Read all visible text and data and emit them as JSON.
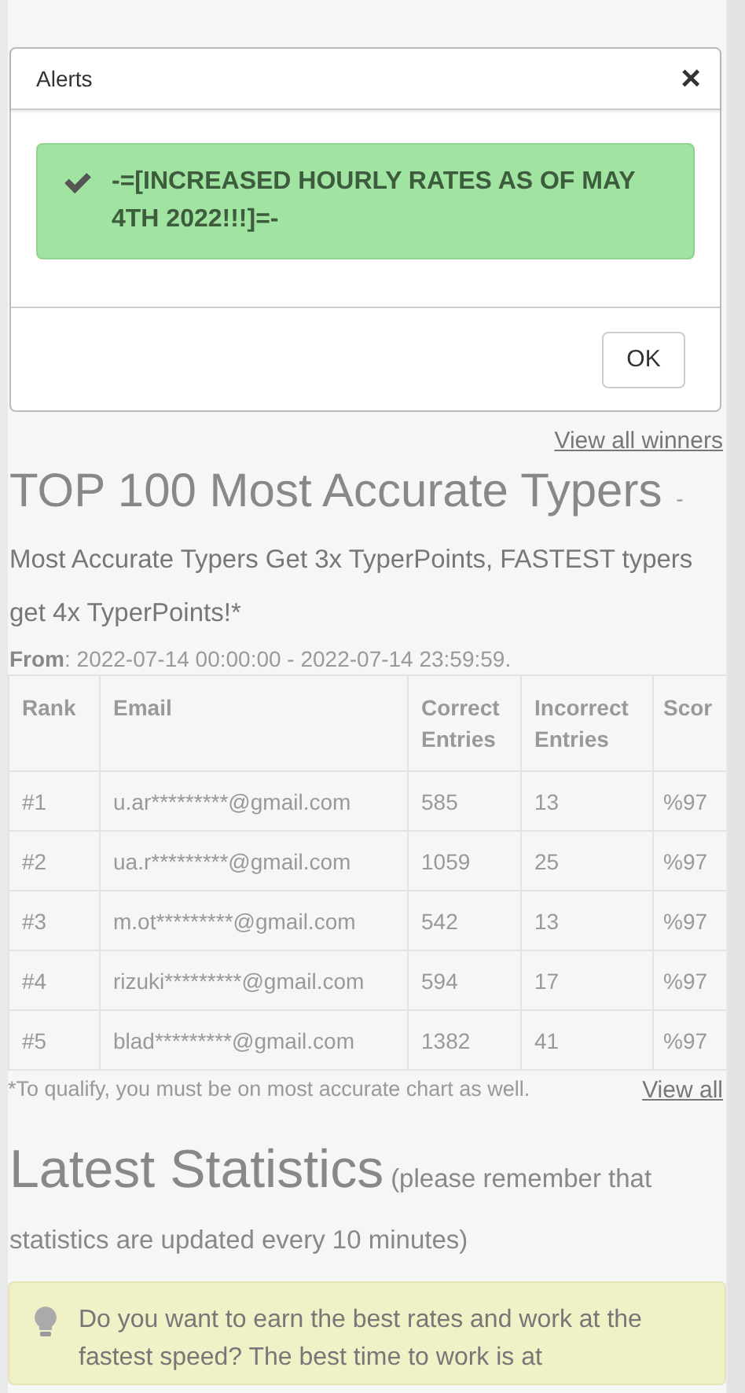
{
  "modal": {
    "title": "Alerts",
    "close": "×",
    "alert": {
      "kind": "success",
      "text": "-=[INCREASED HOURLY RATES AS OF MAY 4TH 2022!!!]=-"
    },
    "button": "OK"
  },
  "winners_link": "View all winners",
  "accurate": {
    "title": "TOP 100 Most Accurate Typers",
    "dash": "-",
    "subtitle": "Most Accurate Typers Get 3x TyperPoints, FASTEST typers get 4x TyperPoints!*",
    "from_label": "From",
    "from_value": ": 2022-07-14 00:00:00 - 2022-07-14 23:59:59.",
    "table": {
      "columns": [
        "Rank",
        "Email",
        "Correct Entries",
        "Incorrect Entries",
        "Scor"
      ],
      "rows": [
        [
          "#1",
          "u.ar*********@gmail.com",
          "585",
          "13",
          "%97"
        ],
        [
          "#2",
          "ua.r*********@gmail.com",
          "1059",
          "25",
          "%97"
        ],
        [
          "#3",
          "m.ot*********@gmail.com",
          "542",
          "13",
          "%97"
        ],
        [
          "#4",
          "rizuki*********@gmail.com",
          "594",
          "17",
          "%97"
        ],
        [
          "#5",
          "blad*********@gmail.com",
          "1382",
          "41",
          "%97"
        ]
      ]
    },
    "footnote": "*To qualify, you must be on most accurate chart as well.",
    "view_all": "View all"
  },
  "stats": {
    "title": "Latest Statistics",
    "note": [
      "(please remember that",
      "statistics are updated every 10 minutes)"
    ],
    "tip": {
      "kind": "info",
      "text": "Do you want to earn the best rates and work at the fastest speed? The best time to work is at"
    }
  }
}
